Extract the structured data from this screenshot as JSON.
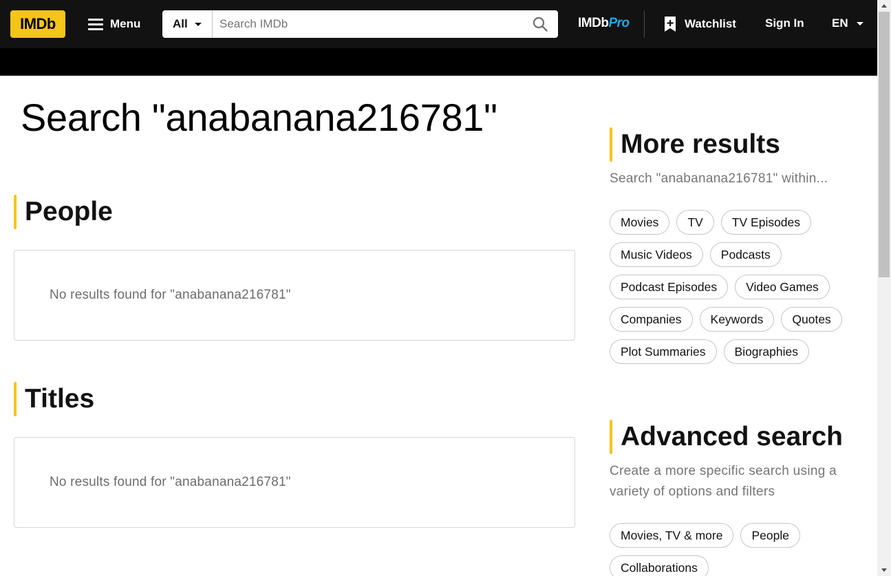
{
  "header": {
    "logo": "IMDb",
    "menu_label": "Menu",
    "search_category": "All",
    "search_placeholder": "Search IMDb",
    "pro_prefix": "IMDb",
    "pro_suffix": "Pro",
    "watchlist_label": "Watchlist",
    "signin_label": "Sign In",
    "language": "EN"
  },
  "page": {
    "title": "Search \"anabanana216781\""
  },
  "sections": {
    "people": {
      "heading": "People",
      "empty_text": "No results found for \"anabanana216781\""
    },
    "titles": {
      "heading": "Titles",
      "empty_text": "No results found for \"anabanana216781\""
    }
  },
  "sidebar": {
    "more_results": {
      "heading": "More results",
      "subtitle": "Search \"anabanana216781\" within...",
      "chips": [
        "Movies",
        "TV",
        "TV Episodes",
        "Music Videos",
        "Podcasts",
        "Podcast Episodes",
        "Video Games",
        "Companies",
        "Keywords",
        "Quotes",
        "Plot Summaries",
        "Biographies"
      ]
    },
    "advanced": {
      "heading": "Advanced search",
      "subtitle": "Create a more specific search using a variety of options and filters",
      "chips": [
        "Movies, TV & more",
        "People",
        "Collaborations"
      ]
    }
  },
  "colors": {
    "accent": "#f5c518",
    "navbar": "#121212",
    "pro_blue": "#26a7de"
  },
  "icons": [
    "menu-icon",
    "caret-down-icon",
    "search-icon",
    "watchlist-add-icon"
  ]
}
